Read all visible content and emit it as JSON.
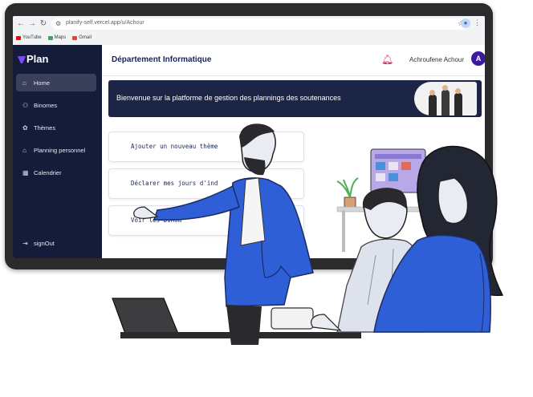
{
  "browser": {
    "url": "planify-self.vercel.app/u/Achour",
    "bookmarks": [
      {
        "label": "YouTube",
        "color": "#ff0000"
      },
      {
        "label": "Maps",
        "color": "#34a853"
      },
      {
        "label": "Gmail",
        "color": "#ea4335"
      }
    ]
  },
  "app": {
    "logo_text": "Plan",
    "sidebar": {
      "items": [
        {
          "label": "Home",
          "icon": "home-icon",
          "active": true
        },
        {
          "label": "Binomes",
          "icon": "users-icon",
          "active": false
        },
        {
          "label": "Thèmes",
          "icon": "palette-icon",
          "active": false
        },
        {
          "label": "Planning personnel",
          "icon": "building-icon",
          "active": false
        },
        {
          "label": "Calendrier",
          "icon": "calendar-icon",
          "active": false
        }
      ],
      "signout_label": "signOut"
    },
    "header": {
      "title": "Département Informatique",
      "user_name": "Achroufene Achour",
      "avatar_letter": "A"
    },
    "banner": {
      "text": "Bienvenue sur la platforme de gestion des plannings des soutenances"
    },
    "actions": [
      {
        "label": "Ajouter un nouveau thème"
      },
      {
        "label": "Déclarer mes jours d'ind"
      },
      {
        "label": "Voir les binom"
      }
    ]
  },
  "colors": {
    "sidebar_bg": "#141c3a",
    "banner_bg": "#1d2547",
    "accent": "#3a1a9e",
    "illustration_blue": "#2f5fd6"
  }
}
